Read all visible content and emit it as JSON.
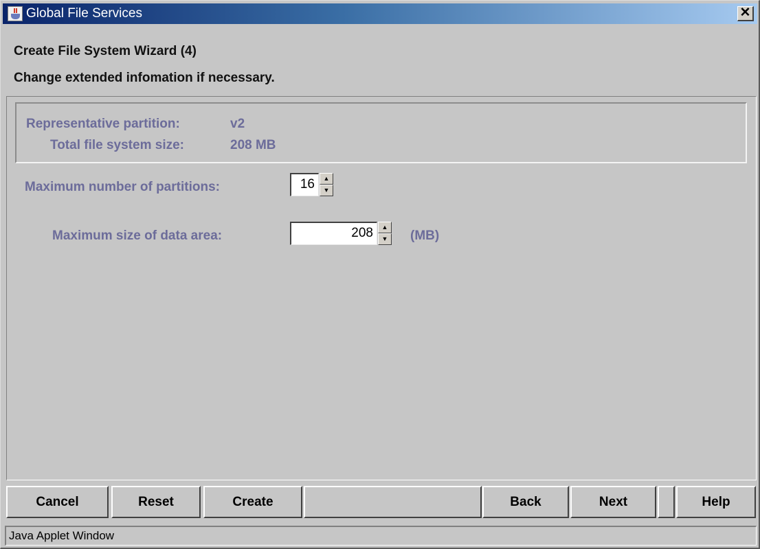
{
  "window": {
    "title": "Global File Services",
    "icon": "java-coffee-cup-icon",
    "close_label": "✕"
  },
  "header": {
    "title": "Create File System Wizard (4)",
    "subtitle": "Change extended infomation if necessary."
  },
  "info": {
    "representative_partition_label": "Representative partition:",
    "representative_partition_value": "v2",
    "total_size_label": "Total file system size:",
    "total_size_value": "208 MB"
  },
  "form": {
    "max_partitions_label": "Maximum number of partitions:",
    "max_partitions_value": "16",
    "max_data_area_label": "Maximum size of data area:",
    "max_data_area_value": "208",
    "max_data_area_unit": "(MB)",
    "spin_up_glyph": "▲",
    "spin_down_glyph": "▼"
  },
  "buttons": {
    "cancel": "Cancel",
    "reset": "Reset",
    "create": "Create",
    "back": "Back",
    "next": "Next",
    "help": "Help"
  },
  "status": {
    "text": "Java Applet Window"
  },
  "colors": {
    "label_text": "#6c6c9a",
    "background": "#c6c6c6",
    "titlebar_start": "#0a246a"
  }
}
